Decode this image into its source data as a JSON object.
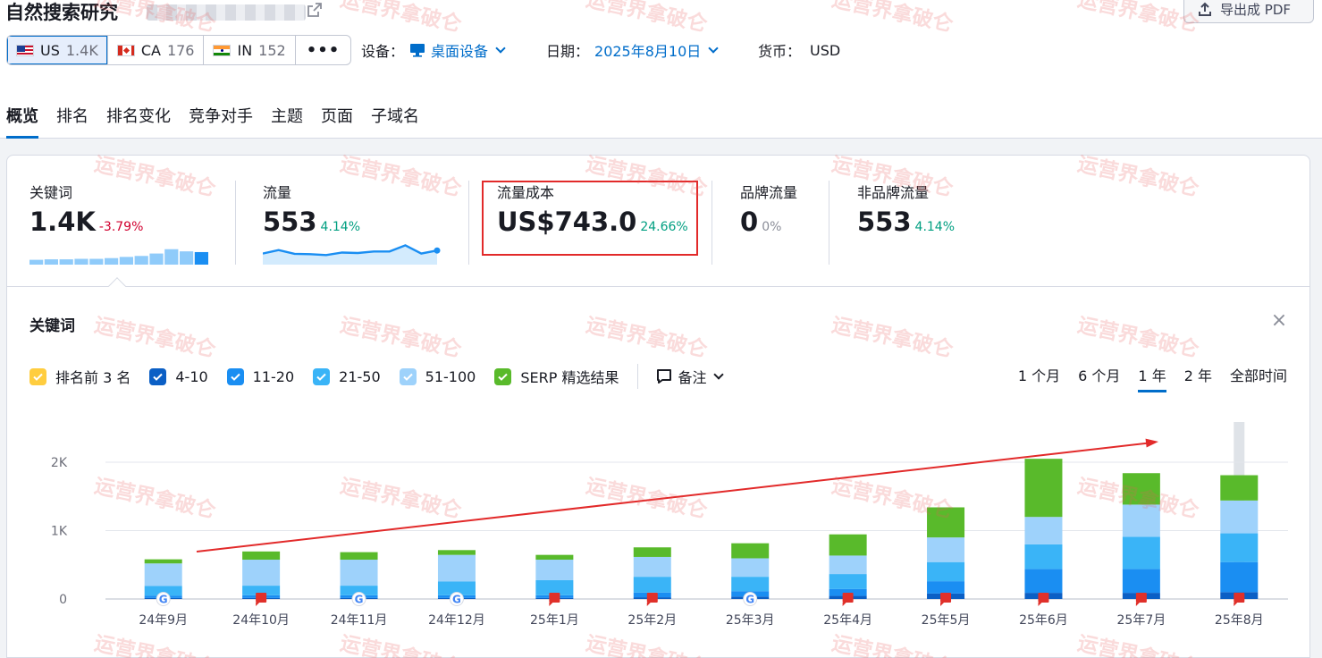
{
  "header": {
    "title": "自然搜索研究",
    "export_label": "导出成 PDF"
  },
  "databases": [
    {
      "code": "US",
      "count": "1.4K",
      "flag": "us"
    },
    {
      "code": "CA",
      "count": "176",
      "flag": "ca"
    },
    {
      "code": "IN",
      "count": "152",
      "flag": "in"
    }
  ],
  "filters": {
    "device_label": "设备：",
    "device_value": "桌面设备",
    "date_label": "日期：",
    "date_value": "2025年8月10日",
    "currency_label": "货币：",
    "currency_value": "USD"
  },
  "tabs": [
    "概览",
    "排名",
    "排名变化",
    "竞争对手",
    "主题",
    "页面",
    "子域名"
  ],
  "metrics": [
    {
      "label": "关键词",
      "value": "1.4K",
      "change": "-3.79%",
      "trend": "neg"
    },
    {
      "label": "流量",
      "value": "553",
      "change": "4.14%",
      "trend": "pos"
    },
    {
      "label": "流量成本",
      "value": "US$743.0",
      "change": "24.66%",
      "trend": "pos"
    },
    {
      "label": "品牌流量",
      "value": "0",
      "change": "0%",
      "trend": "neu"
    },
    {
      "label": "非品牌流量",
      "value": "553",
      "change": "4.14%",
      "trend": "pos"
    }
  ],
  "keyword_spark": [
    0.2,
    0.22,
    0.22,
    0.24,
    0.24,
    0.27,
    0.32,
    0.36,
    0.46,
    0.64,
    0.55,
    0.52
  ],
  "traffic_spark": [
    0.45,
    0.62,
    0.44,
    0.42,
    0.38,
    0.5,
    0.48,
    0.55,
    0.55,
    0.85,
    0.45,
    0.6
  ],
  "section": {
    "title": "关键词",
    "notes_label": "备注",
    "close_icon": "close-icon"
  },
  "legend": [
    {
      "label": "排名前 3 名",
      "color": "#ffcd3f"
    },
    {
      "label": "4-10",
      "color": "#0b5fc5"
    },
    {
      "label": "11-20",
      "color": "#1a8ef2"
    },
    {
      "label": "21-50",
      "color": "#3ab4f7"
    },
    {
      "label": "51-100",
      "color": "#9ed2fb"
    },
    {
      "label": "SERP 精选结果",
      "color": "#59ba2b"
    }
  ],
  "ranges": [
    "1 个月",
    "6 个月",
    "1 年",
    "2 年",
    "全部时间"
  ],
  "active_range": "1 年",
  "watermark_text": "运营界拿破仑",
  "chart_data": {
    "type": "bar",
    "stacked": true,
    "categories": [
      "24年9月",
      "24年10月",
      "24年11月",
      "24年12月",
      "25年1月",
      "25年2月",
      "25年3月",
      "25年4月",
      "25年5月",
      "25年6月",
      "25年7月",
      "25年8月"
    ],
    "ylim": [
      0,
      2500
    ],
    "yticks": [
      {
        "value": 0,
        "label": "0"
      },
      {
        "value": 1000,
        "label": "1K"
      },
      {
        "value": 2000,
        "label": "2K"
      }
    ],
    "series": [
      {
        "name": "排名前 3 名",
        "color": "#ffcd3f",
        "values": [
          0,
          0,
          0,
          0,
          0,
          0,
          0,
          0,
          0,
          0,
          0,
          0
        ]
      },
      {
        "name": "4-10",
        "color": "#0b5fc5",
        "values": [
          15,
          15,
          15,
          15,
          15,
          25,
          35,
          45,
          80,
          90,
          90,
          100
        ]
      },
      {
        "name": "11-20",
        "color": "#1a8ef2",
        "values": [
          35,
          40,
          40,
          40,
          40,
          70,
          80,
          100,
          180,
          350,
          350,
          440
        ]
      },
      {
        "name": "21-50",
        "color": "#3ab4f7",
        "values": [
          140,
          140,
          140,
          200,
          220,
          230,
          210,
          220,
          280,
          360,
          470,
          420
        ]
      },
      {
        "name": "51-100",
        "color": "#9ed2fb",
        "values": [
          330,
          380,
          380,
          390,
          300,
          290,
          270,
          270,
          360,
          400,
          470,
          480
        ]
      },
      {
        "name": "SERP 精选结果",
        "color": "#59ba2b",
        "values": [
          60,
          120,
          110,
          70,
          70,
          140,
          220,
          310,
          440,
          850,
          460,
          370
        ]
      }
    ],
    "markers": [
      "google-icon",
      "note-flag-icon",
      "google-icon",
      "google-icon",
      "note-flag-icon",
      "note-flag-icon",
      "google-icon",
      "note-flag-icon",
      "note-flag-icon",
      "note-flag-icon",
      "note-flag-icon",
      "note-flag-icon"
    ],
    "highlighted_category": "25年8月"
  }
}
